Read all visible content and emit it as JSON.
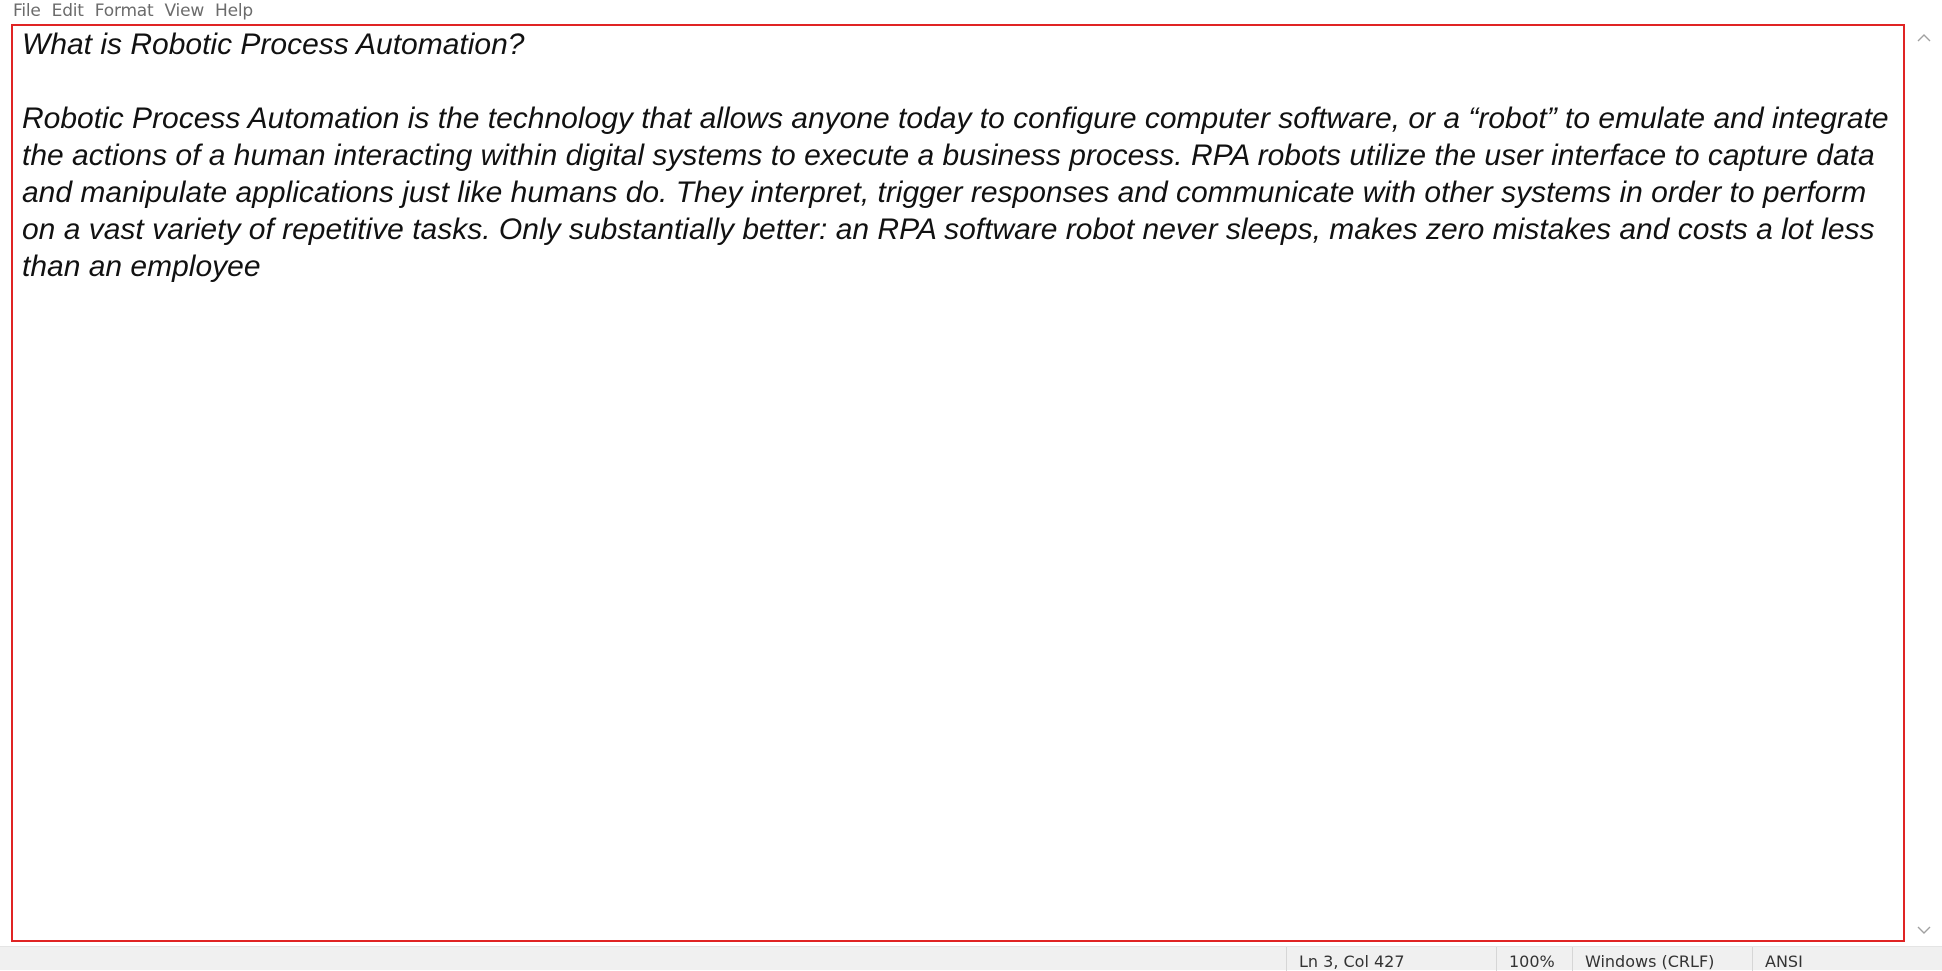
{
  "menu": {
    "items": [
      "File",
      "Edit",
      "Format",
      "View",
      "Help"
    ]
  },
  "editor": {
    "content": "What is Robotic Process Automation?\n\nRobotic Process Automation is the technology that allows anyone today to configure computer software, or a “robot” to emulate and integrate the actions of a human interacting within digital systems to execute a business process. RPA robots utilize the user interface to capture data and manipulate applications just like humans do. They interpret, trigger responses and communicate with other systems in order to perform on a vast variety of repetitive tasks. Only substantially better: an RPA software robot never sleeps, makes zero mistakes and costs a lot less than an employee"
  },
  "scrollbar": {
    "up_icon": "chevron-up-icon",
    "down_icon": "chevron-down-icon"
  },
  "status": {
    "position": "Ln 3, Col 427",
    "zoom": "100%",
    "line_ending": "Windows (CRLF)",
    "encoding": "ANSI"
  },
  "colors": {
    "focus_border": "#e02424",
    "menu_text": "#6b6b6b",
    "statusbar_bg": "#f0f0f0"
  }
}
